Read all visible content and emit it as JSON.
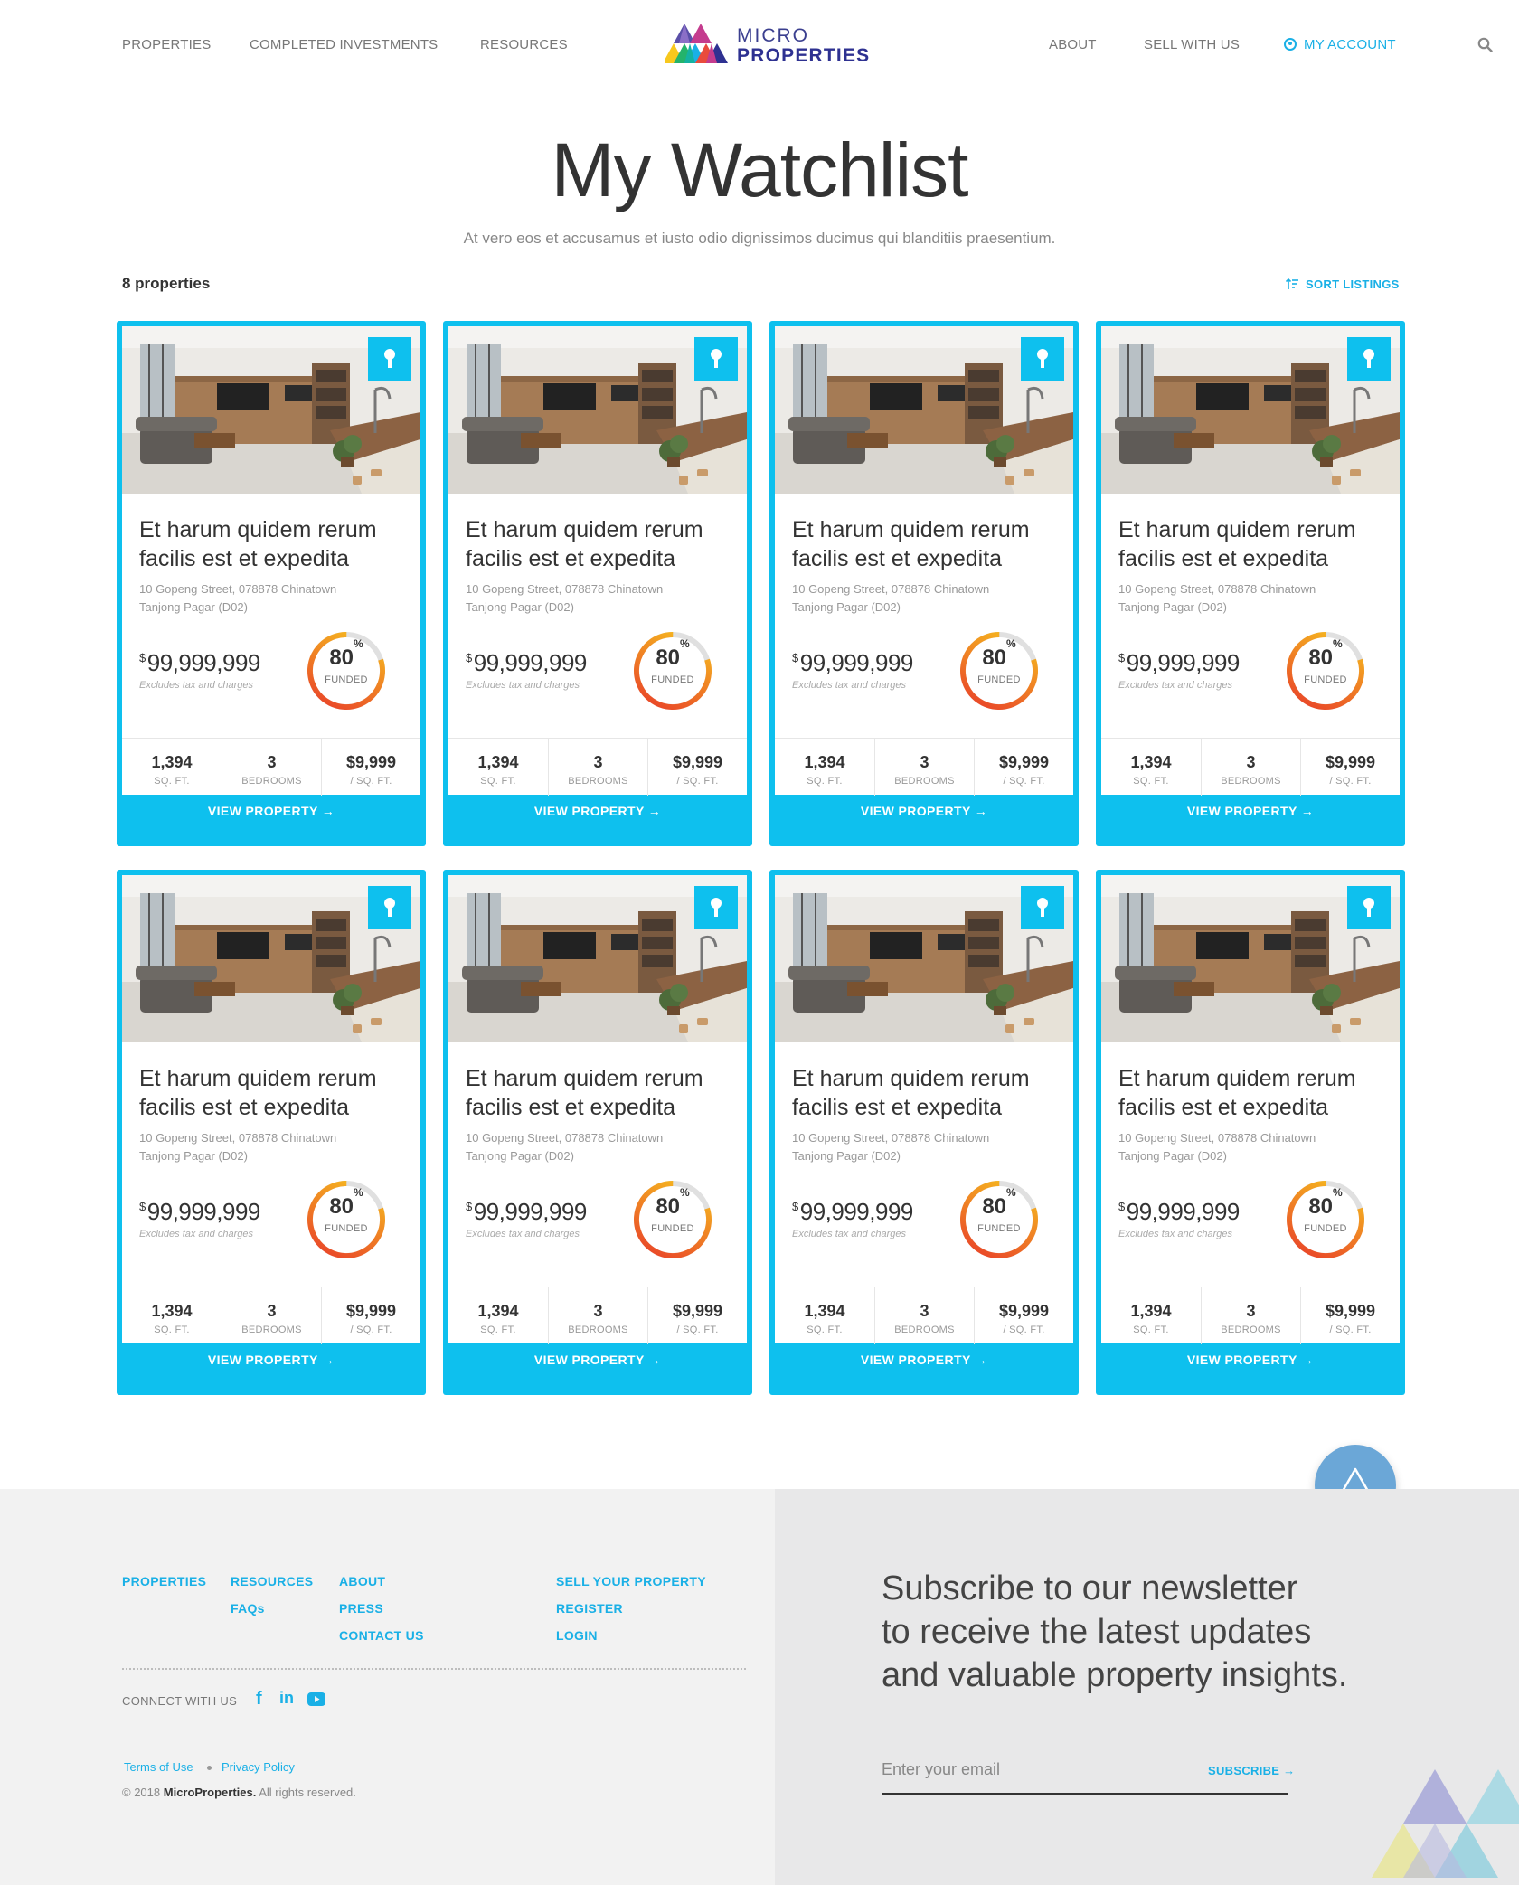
{
  "nav": {
    "left": [
      "PROPERTIES",
      "COMPLETED INVESTMENTS",
      "RESOURCES"
    ],
    "logo_line1": "MICRO",
    "logo_line2": "PROPERTIES",
    "right": [
      "ABOUT",
      "SELL WITH US"
    ],
    "account": "MY ACCOUNT",
    "search_icon": "search-icon"
  },
  "hero": {
    "title": "My Watchlist",
    "subtitle": "At vero eos et accusamus et iusto odio dignissimos ducimus qui blanditiis praesentium."
  },
  "listing": {
    "count": "8 properties",
    "sort": "SORT LISTINGS"
  },
  "cards": [
    {
      "title": "Et harum quidem rerum facilis est et expedita",
      "address_line1": "10 Gopeng Street, 078878 Chinatown",
      "address_line2": "Tanjong Pagar (D02)",
      "currency": "$",
      "price": "99,999,999",
      "price_note": "Excludes tax and charges",
      "funded_pct": 80,
      "funded_num": "80",
      "funded_unit": "%",
      "funded_label": "FUNDED",
      "sqft": "1,394",
      "sqft_label": "SQ. FT.",
      "bedrooms": "3",
      "bedrooms_label": "BEDROOMS",
      "psf": "$9,999",
      "psf_label": "/ SQ. FT.",
      "cta": "VIEW PROPERTY →"
    },
    {
      "title": "Et harum quidem rerum facilis est et expedita",
      "address_line1": "10 Gopeng Street, 078878 Chinatown",
      "address_line2": "Tanjong Pagar (D02)",
      "currency": "$",
      "price": "99,999,999",
      "price_note": "Excludes tax and charges",
      "funded_pct": 80,
      "funded_num": "80",
      "funded_unit": "%",
      "funded_label": "FUNDED",
      "sqft": "1,394",
      "sqft_label": "SQ. FT.",
      "bedrooms": "3",
      "bedrooms_label": "BEDROOMS",
      "psf": "$9,999",
      "psf_label": "/ SQ. FT.",
      "cta": "VIEW PROPERTY →"
    },
    {
      "title": "Et harum quidem rerum facilis est et expedita",
      "address_line1": "10 Gopeng Street, 078878 Chinatown",
      "address_line2": "Tanjong Pagar (D02)",
      "currency": "$",
      "price": "99,999,999",
      "price_note": "Excludes tax and charges",
      "funded_pct": 80,
      "funded_num": "80",
      "funded_unit": "%",
      "funded_label": "FUNDED",
      "sqft": "1,394",
      "sqft_label": "SQ. FT.",
      "bedrooms": "3",
      "bedrooms_label": "BEDROOMS",
      "psf": "$9,999",
      "psf_label": "/ SQ. FT.",
      "cta": "VIEW PROPERTY →"
    },
    {
      "title": "Et harum quidem rerum facilis est et expedita",
      "address_line1": "10 Gopeng Street, 078878 Chinatown",
      "address_line2": "Tanjong Pagar (D02)",
      "currency": "$",
      "price": "99,999,999",
      "price_note": "Excludes tax and charges",
      "funded_pct": 80,
      "funded_num": "80",
      "funded_unit": "%",
      "funded_label": "FUNDED",
      "sqft": "1,394",
      "sqft_label": "SQ. FT.",
      "bedrooms": "3",
      "bedrooms_label": "BEDROOMS",
      "psf": "$9,999",
      "psf_label": "/ SQ. FT.",
      "cta": "VIEW PROPERTY →"
    },
    {
      "title": "Et harum quidem rerum facilis est et expedita",
      "address_line1": "10 Gopeng Street, 078878 Chinatown",
      "address_line2": "Tanjong Pagar (D02)",
      "currency": "$",
      "price": "99,999,999",
      "price_note": "Excludes tax and charges",
      "funded_pct": 80,
      "funded_num": "80",
      "funded_unit": "%",
      "funded_label": "FUNDED",
      "sqft": "1,394",
      "sqft_label": "SQ. FT.",
      "bedrooms": "3",
      "bedrooms_label": "BEDROOMS",
      "psf": "$9,999",
      "psf_label": "/ SQ. FT.",
      "cta": "VIEW PROPERTY →"
    },
    {
      "title": "Et harum quidem rerum facilis est et expedita",
      "address_line1": "10 Gopeng Street, 078878 Chinatown",
      "address_line2": "Tanjong Pagar (D02)",
      "currency": "$",
      "price": "99,999,999",
      "price_note": "Excludes tax and charges",
      "funded_pct": 80,
      "funded_num": "80",
      "funded_unit": "%",
      "funded_label": "FUNDED",
      "sqft": "1,394",
      "sqft_label": "SQ. FT.",
      "bedrooms": "3",
      "bedrooms_label": "BEDROOMS",
      "psf": "$9,999",
      "psf_label": "/ SQ. FT.",
      "cta": "VIEW PROPERTY →"
    },
    {
      "title": "Et harum quidem rerum facilis est et expedita",
      "address_line1": "10 Gopeng Street, 078878 Chinatown",
      "address_line2": "Tanjong Pagar (D02)",
      "currency": "$",
      "price": "99,999,999",
      "price_note": "Excludes tax and charges",
      "funded_pct": 80,
      "funded_num": "80",
      "funded_unit": "%",
      "funded_label": "FUNDED",
      "sqft": "1,394",
      "sqft_label": "SQ. FT.",
      "bedrooms": "3",
      "bedrooms_label": "BEDROOMS",
      "psf": "$9,999",
      "psf_label": "/ SQ. FT.",
      "cta": "VIEW PROPERTY →"
    },
    {
      "title": "Et harum quidem rerum facilis est et expedita",
      "address_line1": "10 Gopeng Street, 078878 Chinatown",
      "address_line2": "Tanjong Pagar (D02)",
      "currency": "$",
      "price": "99,999,999",
      "price_note": "Excludes tax and charges",
      "funded_pct": 80,
      "funded_num": "80",
      "funded_unit": "%",
      "funded_label": "FUNDED",
      "sqft": "1,394",
      "sqft_label": "SQ. FT.",
      "bedrooms": "3",
      "bedrooms_label": "BEDROOMS",
      "psf": "$9,999",
      "psf_label": "/ SQ. FT.",
      "cta": "VIEW PROPERTY →"
    }
  ],
  "footer": {
    "col1": [
      "PROPERTIES"
    ],
    "col2": [
      "RESOURCES",
      "FAQs"
    ],
    "col3": [
      "ABOUT",
      "PRESS",
      "CONTACT US"
    ],
    "col4": [
      "SELL YOUR PROPERTY",
      "REGISTER",
      "LOGIN"
    ],
    "connect": "CONNECT WITH US",
    "social_icons": [
      "facebook-icon",
      "linkedin-icon",
      "youtube-icon"
    ],
    "social_glyphs": [
      "f",
      "in"
    ],
    "terms": "Terms of Use",
    "privacy": "Privacy Policy",
    "copyright_prefix": "© 2018",
    "copyright_brand": "MicroProperties.",
    "copyright_suffix": "All rights reserved.",
    "newsletter_line1": "Subscribe to our newsletter",
    "newsletter_line2": "to receive the latest updates",
    "newsletter_line3": "and valuable property insights.",
    "email_placeholder": "Enter your email",
    "subscribe": "SUBSCRIBE →"
  },
  "colors": {
    "accent": "#0ec0ee",
    "ring_start": "#e83a2a",
    "ring_end": "#f7c81e",
    "ring_track": "#e0e0e0"
  }
}
